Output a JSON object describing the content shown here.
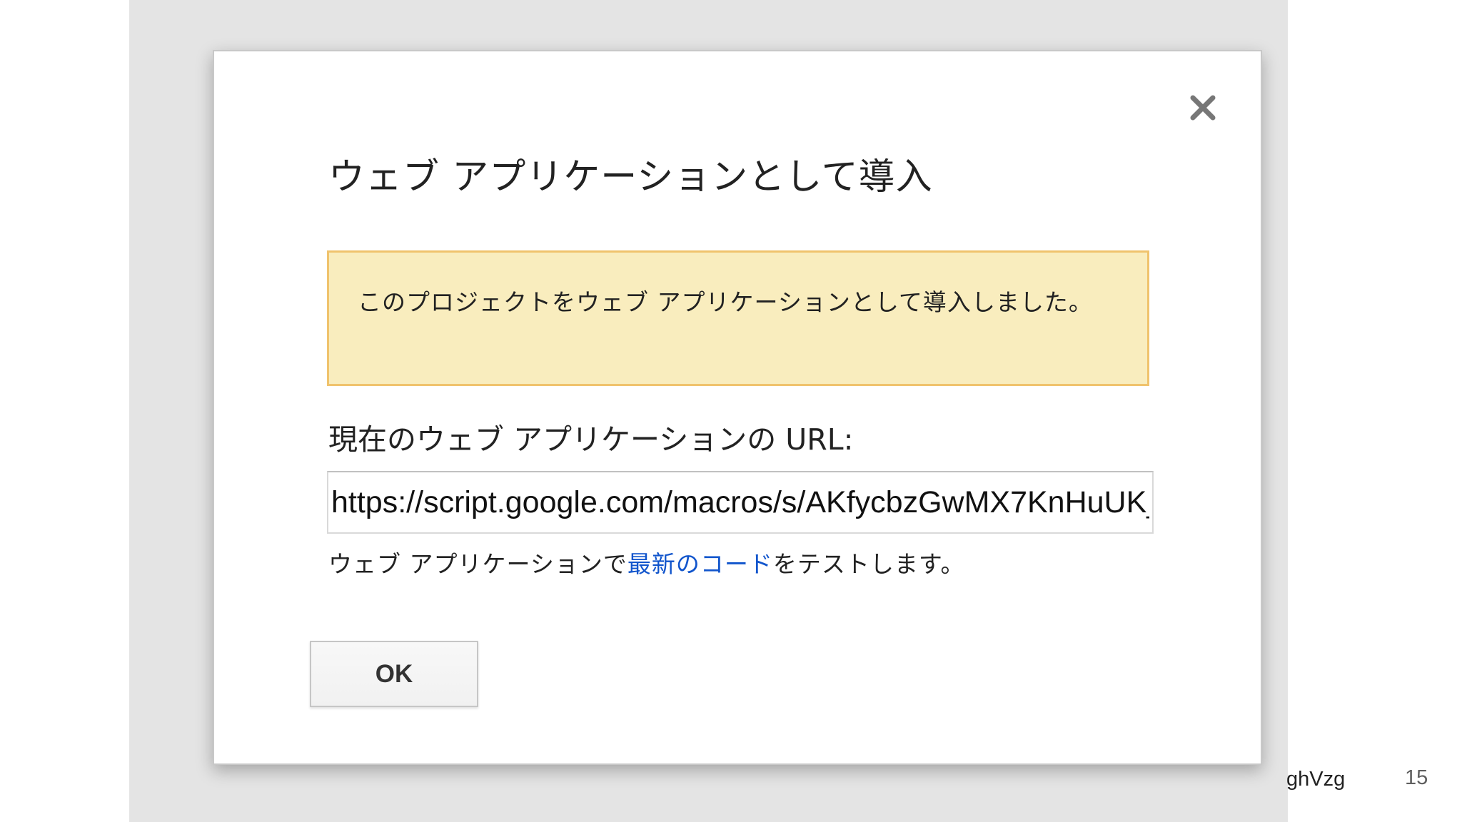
{
  "dialog": {
    "title": "ウェブ アプリケーションとして導入",
    "close_icon": "close-icon",
    "notice": "このプロジェクトをウェブ アプリケーションとして導入しました。",
    "url_label": "現在のウェブ アプリケーションの URL:",
    "url_value": "https://script.google.com/macros/s/AKfycbzGwMX7KnHuUK_",
    "test_prefix": "ウェブ アプリケーションで",
    "test_link": "最新のコード",
    "test_suffix": "をテストします。",
    "ok_label": "OK"
  },
  "slide": {
    "footer_fragment": "ghVzg",
    "page_number": "15"
  },
  "colors": {
    "notice_background": "#f9edbe",
    "notice_border": "#f0c36d",
    "link": "#1155cc",
    "backdrop": "#e4e4e4"
  }
}
